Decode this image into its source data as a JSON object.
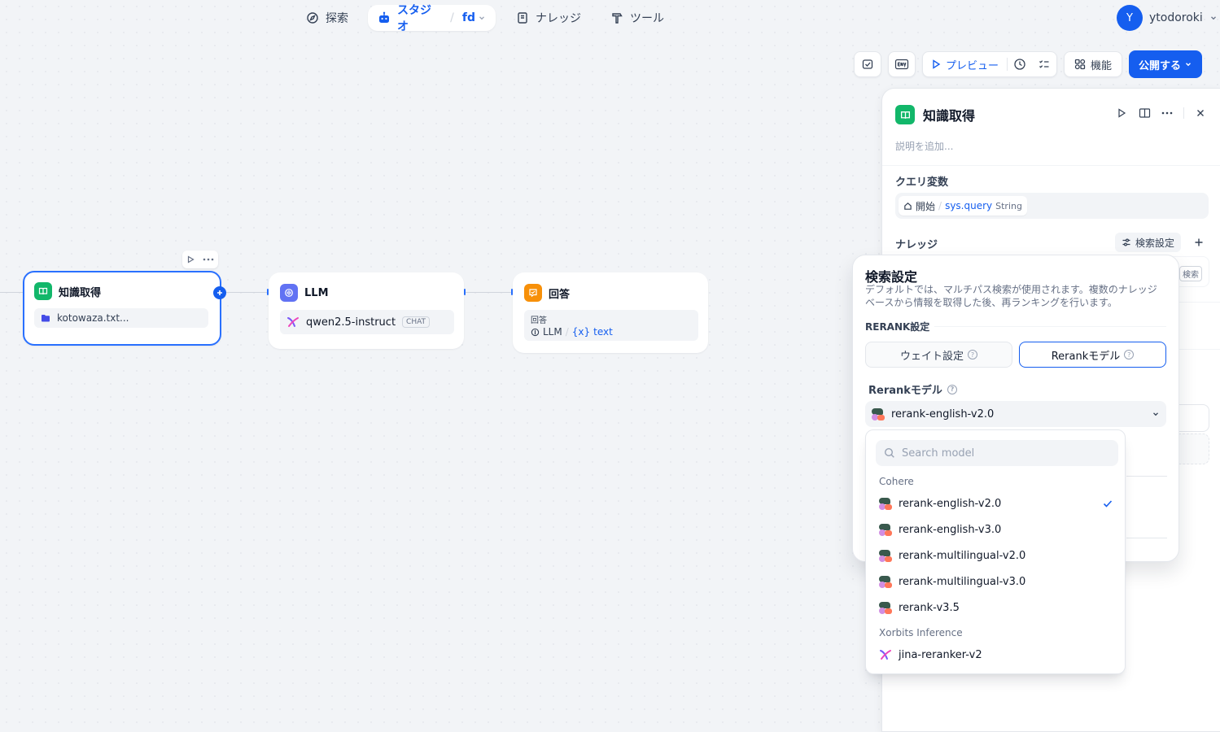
{
  "nav": {
    "explore": "探索",
    "studio": "スタジオ",
    "app_name": "fd",
    "knowledge": "ナレッジ",
    "tools": "ツール",
    "user_initial": "Y",
    "user_name": "ytodoroki"
  },
  "toolbar": {
    "preview": "プレビュー",
    "features": "機能",
    "publish": "公開する"
  },
  "nodes": {
    "retrieval": {
      "title": "知識取得",
      "dataset": "kotowaza.txt..."
    },
    "llm": {
      "title": "LLM",
      "model": "qwen2.5-instruct",
      "mode": "CHAT"
    },
    "answer": {
      "title": "回答",
      "label": "回答",
      "source_node": "LLM",
      "var_prefix": "{x}",
      "var": "text"
    }
  },
  "panel": {
    "title": "知識取得",
    "description_placeholder": "説明を追加...",
    "query_var_title": "クエリ変数",
    "query_node": "開始",
    "query_var": "sys.query",
    "query_type": "String",
    "knowledge_title": "ナレッジ",
    "retrieval_setting_btn": "検索設定",
    "peek_badge": "検索"
  },
  "popover": {
    "title": "検索設定",
    "description": "デフォルトでは、マルチパス検索が使用されます。複数のナレッジベースから情報を取得した後、再ランキングを行います。",
    "rerank_settings": "RERANK設定",
    "weight_tab": "ウェイト設定",
    "rerank_tab": "Rerankモデル",
    "model_label": "Rerankモデル",
    "selected_model": "rerank-english-v2.0"
  },
  "dropdown": {
    "search_placeholder": "Search model",
    "groups": [
      {
        "name": "Cohere",
        "models": [
          "rerank-english-v2.0",
          "rerank-english-v3.0",
          "rerank-multilingual-v2.0",
          "rerank-multilingual-v3.0",
          "rerank-v3.5"
        ]
      },
      {
        "name": "Xorbits Inference",
        "models": [
          "jina-reranker-v2"
        ]
      }
    ]
  },
  "colors": {
    "accent": "#155eef",
    "retrieval_icon": "#12b76a",
    "llm_icon": "#6172f3",
    "answer_icon": "#f79009"
  }
}
